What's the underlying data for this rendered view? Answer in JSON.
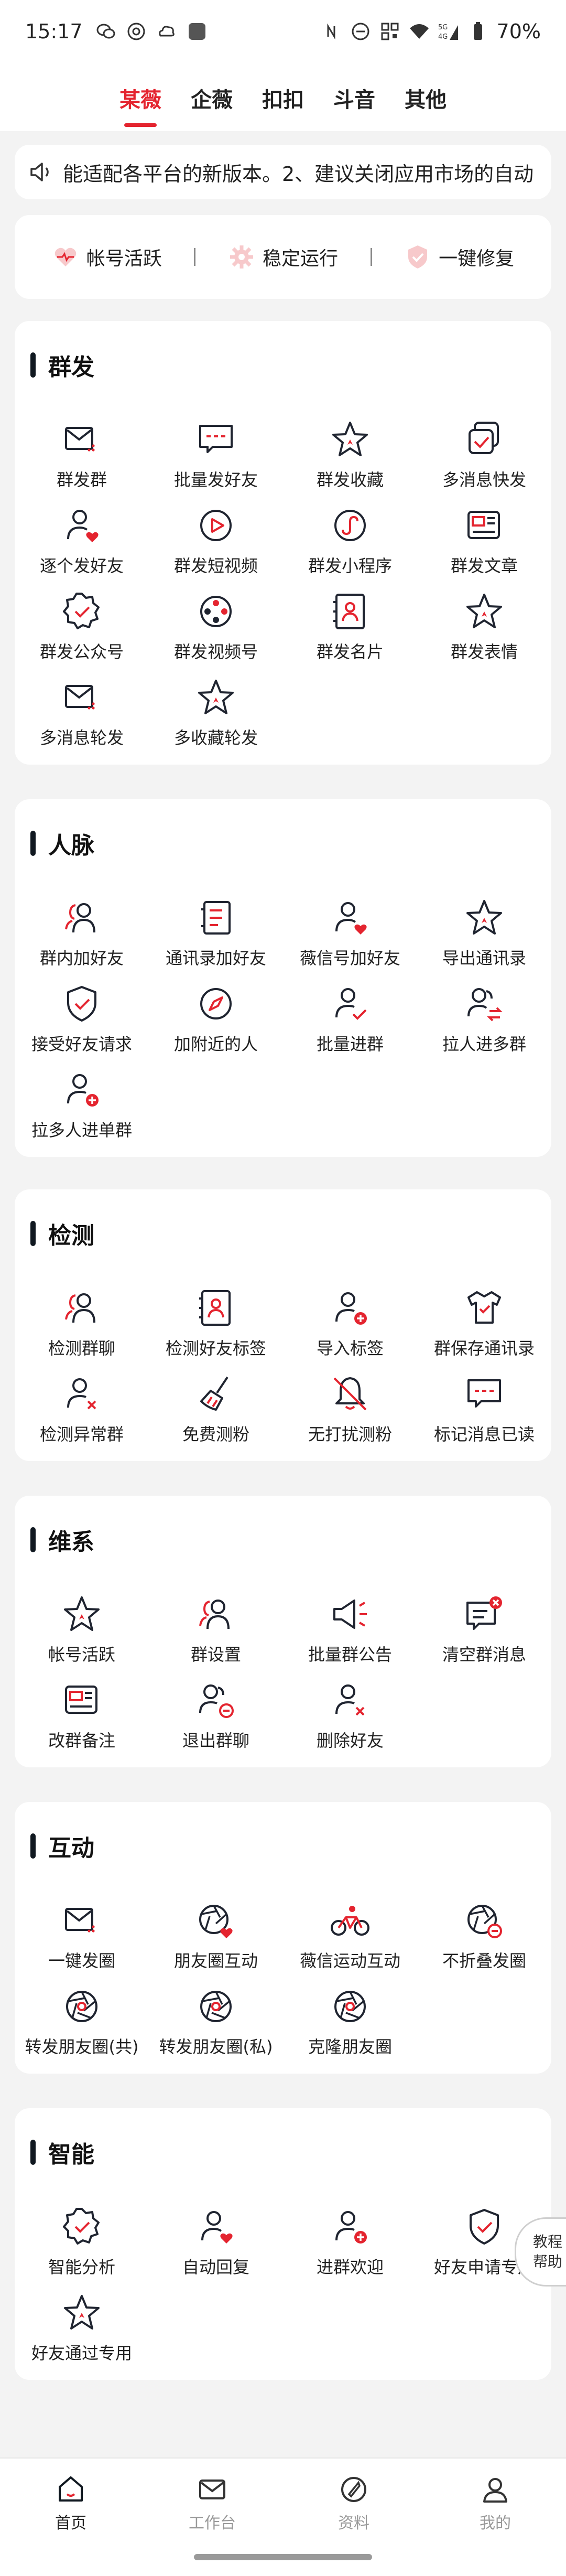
{
  "status_bar": {
    "time": "15:17",
    "battery": "70%",
    "icons_left": [
      "wechat-icon",
      "target-icon",
      "cloud-icon",
      "app-square-icon"
    ],
    "icons_right": [
      "nfc-icon",
      "dnd-icon",
      "qr-icon",
      "wifi-icon",
      "signal-5g-icon",
      "battery-icon"
    ]
  },
  "top_tabs": [
    {
      "label": "某薇",
      "active": true
    },
    {
      "label": "企薇",
      "active": false
    },
    {
      "label": "扣扣",
      "active": false
    },
    {
      "label": "斗音",
      "active": false
    },
    {
      "label": "其他",
      "active": false
    }
  ],
  "notice": {
    "icon": "speaker-icon",
    "text": "能适配各平台的新版本。2、建议关闭应用市场的自动"
  },
  "status_strip": [
    {
      "label": "帐号活跃",
      "icon": "heart-pulse-icon"
    },
    {
      "label": "稳定运行",
      "icon": "gear-icon"
    },
    {
      "label": "一键修复",
      "icon": "shield-check-icon"
    }
  ],
  "sections": [
    {
      "title": "群发",
      "items": [
        {
          "label": "群发群",
          "icon": "envelope-icon"
        },
        {
          "label": "批量发好友",
          "icon": "chat-dash-icon"
        },
        {
          "label": "群发收藏",
          "icon": "star-icon"
        },
        {
          "label": "多消息快发",
          "icon": "stack-check-icon"
        },
        {
          "label": "逐个发好友",
          "icon": "user-heart-icon"
        },
        {
          "label": "群发短视频",
          "icon": "play-circle-icon"
        },
        {
          "label": "群发小程序",
          "icon": "mini-program-icon"
        },
        {
          "label": "群发文章",
          "icon": "article-icon"
        },
        {
          "label": "群发公众号",
          "icon": "badge-check-icon"
        },
        {
          "label": "群发视频号",
          "icon": "reel-icon"
        },
        {
          "label": "群发名片",
          "icon": "contact-card-icon"
        },
        {
          "label": "群发表情",
          "icon": "star-icon"
        },
        {
          "label": "多消息轮发",
          "icon": "envelope-icon"
        },
        {
          "label": "多收藏轮发",
          "icon": "star-icon"
        }
      ]
    },
    {
      "title": "人脉",
      "items": [
        {
          "label": "群内加好友",
          "icon": "users-icon"
        },
        {
          "label": "通讯录加好友",
          "icon": "address-book-icon"
        },
        {
          "label": "薇信号加好友",
          "icon": "user-heart-icon"
        },
        {
          "label": "导出通讯录",
          "icon": "star-icon"
        },
        {
          "label": "接受好友请求",
          "icon": "shield-check-icon"
        },
        {
          "label": "加附近的人",
          "icon": "compass-icon"
        },
        {
          "label": "批量进群",
          "icon": "user-check-icon"
        },
        {
          "label": "拉人进多群",
          "icon": "users-swap-icon"
        },
        {
          "label": "拉多人进单群",
          "icon": "user-plus-icon"
        }
      ]
    },
    {
      "title": "检测",
      "items": [
        {
          "label": "检测群聊",
          "icon": "users-icon"
        },
        {
          "label": "检测好友标签",
          "icon": "contact-card-icon"
        },
        {
          "label": "导入标签",
          "icon": "user-plus-icon"
        },
        {
          "label": "群保存通讯录",
          "icon": "shirt-icon"
        },
        {
          "label": "检测异常群",
          "icon": "user-x-icon"
        },
        {
          "label": "免费测粉",
          "icon": "broom-icon"
        },
        {
          "label": "无打扰测粉",
          "icon": "bell-off-icon"
        },
        {
          "label": "标记消息已读",
          "icon": "chat-dash-icon"
        }
      ]
    },
    {
      "title": "维系",
      "items": [
        {
          "label": "帐号活跃",
          "icon": "star-icon"
        },
        {
          "label": "群设置",
          "icon": "users-icon"
        },
        {
          "label": "批量群公告",
          "icon": "megaphone-icon"
        },
        {
          "label": "清空群消息",
          "icon": "chat-x-icon"
        },
        {
          "label": "改群备注",
          "icon": "article-icon"
        },
        {
          "label": "退出群聊",
          "icon": "users-minus-icon"
        },
        {
          "label": "删除好友",
          "icon": "user-x-icon"
        }
      ]
    },
    {
      "title": "互动",
      "items": [
        {
          "label": "一键发圈",
          "icon": "envelope-icon"
        },
        {
          "label": "朋友圈互动",
          "icon": "aperture-heart-icon"
        },
        {
          "label": "薇信运动互动",
          "icon": "bike-icon"
        },
        {
          "label": "不折叠发圈",
          "icon": "aperture-minus-icon"
        },
        {
          "label": "转发朋友圈(共)",
          "icon": "aperture-icon"
        },
        {
          "label": "转发朋友圈(私)",
          "icon": "aperture-icon"
        },
        {
          "label": "克隆朋友圈",
          "icon": "aperture-icon"
        }
      ]
    },
    {
      "title": "智能",
      "items": [
        {
          "label": "智能分析",
          "icon": "badge-check-icon"
        },
        {
          "label": "自动回复",
          "icon": "user-heart-icon"
        },
        {
          "label": "进群欢迎",
          "icon": "user-plus-icon"
        },
        {
          "label": "好友申请专用",
          "icon": "shield-check-icon"
        },
        {
          "label": "好友通过专用",
          "icon": "star-icon"
        }
      ]
    }
  ],
  "float_help": {
    "line1": "教程",
    "line2": "帮助"
  },
  "bottom_nav": [
    {
      "label": "首页",
      "icon": "home-icon",
      "active": true
    },
    {
      "label": "工作台",
      "icon": "mail-icon",
      "active": false
    },
    {
      "label": "资料",
      "icon": "compass-pen-icon",
      "active": false
    },
    {
      "label": "我的",
      "icon": "user-icon",
      "active": false
    }
  ],
  "colors": {
    "accent": "#e4242f",
    "dark": "#101820",
    "background": "#f3f3f3"
  }
}
